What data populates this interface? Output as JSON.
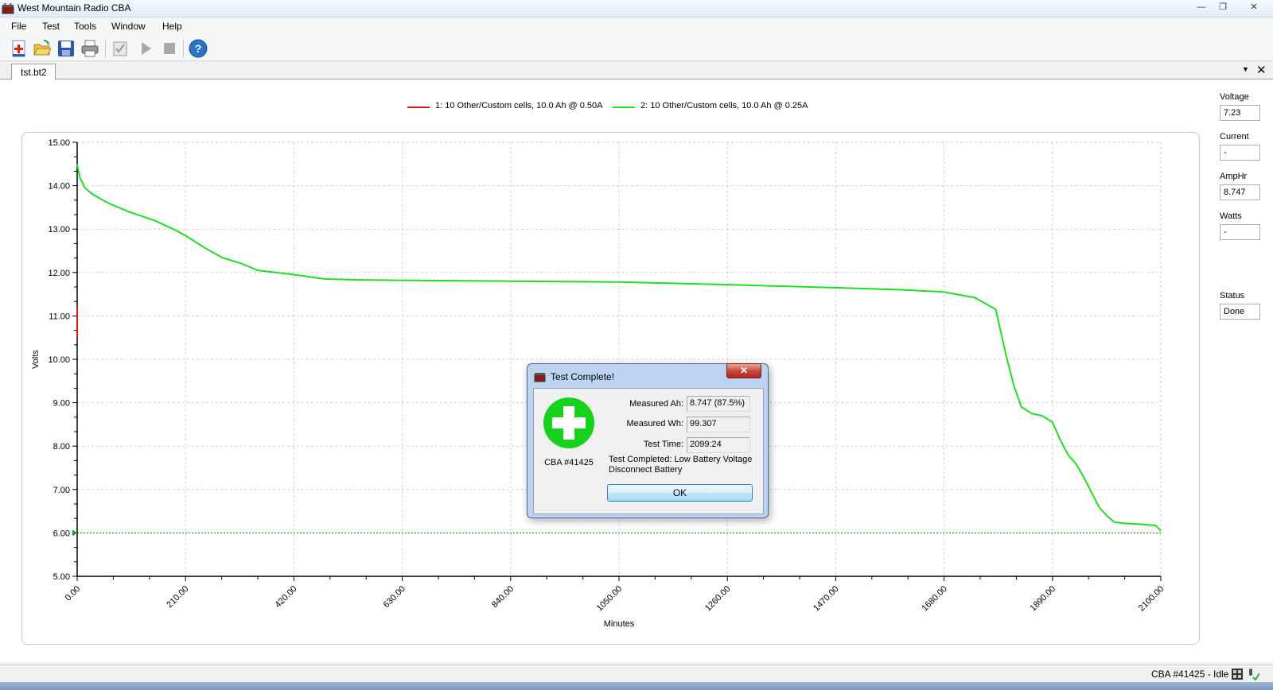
{
  "window": {
    "title": "West Mountain Radio CBA"
  },
  "menu": [
    "File",
    "Test",
    "Tools",
    "Window",
    "Help"
  ],
  "toolbar": [
    "new-icon",
    "open-icon",
    "save-icon",
    "print-icon",
    "checklist-icon",
    "play-icon",
    "stop-icon",
    "help-icon"
  ],
  "tab": {
    "label": "tst.bt2"
  },
  "legend": [
    {
      "label": "1: 10 Other/Custom cells, 10.0 Ah @ 0.50A",
      "color": "#c8201e"
    },
    {
      "label": "2: 10 Other/Custom cells, 10.0 Ah @ 0.25A",
      "color": "#22dd22"
    }
  ],
  "readouts": [
    {
      "label": "Voltage",
      "value": "7.23"
    },
    {
      "label": "Current",
      "value": "-"
    },
    {
      "label": "AmpHr",
      "value": "8.747"
    },
    {
      "label": "Watts",
      "value": "-"
    },
    {
      "label": "Status",
      "value": "Done"
    }
  ],
  "chart_data": {
    "type": "line",
    "xlabel": "Minutes",
    "ylabel": "Volts",
    "xlim": [
      0,
      2100
    ],
    "ylim": [
      5,
      15
    ],
    "xticks": [
      "0.00",
      "210.00",
      "420.00",
      "630.00",
      "840.00",
      "1050.00",
      "1260.00",
      "1470.00",
      "1680.00",
      "1890.00",
      "2100.00"
    ],
    "yticks": [
      "15.00",
      "14.00",
      "13.00",
      "12.00",
      "11.00",
      "10.00",
      "9.00",
      "8.00",
      "7.00",
      "6.00",
      "5.00"
    ],
    "grid": true,
    "cutoff_voltage": 6.0,
    "series": [
      {
        "name": "1: 10 Other/Custom cells, 10.0 Ah @ 0.50A",
        "color": "#c8201e",
        "x": [
          0,
          0
        ],
        "y": [
          10.5,
          11.2
        ]
      },
      {
        "name": "2: 10 Other/Custom cells, 10.0 Ah @ 0.25A",
        "color": "#22dd22",
        "x": [
          0,
          5,
          15,
          30,
          60,
          100,
          150,
          190,
          210,
          250,
          280,
          320,
          350,
          400,
          420,
          480,
          550,
          630,
          840,
          1050,
          1260,
          1470,
          1600,
          1680,
          1740,
          1780,
          1800,
          1815,
          1830,
          1850,
          1870,
          1890,
          1905,
          1920,
          1935,
          1950,
          1965,
          1980,
          1995,
          2010,
          2030,
          2060,
          2090,
          2100
        ],
        "y": [
          14.5,
          14.2,
          13.95,
          13.8,
          13.6,
          13.4,
          13.2,
          12.98,
          12.85,
          12.55,
          12.35,
          12.2,
          12.05,
          11.98,
          11.95,
          11.85,
          11.83,
          11.82,
          11.8,
          11.78,
          11.72,
          11.65,
          11.6,
          11.55,
          11.42,
          11.15,
          10.1,
          9.4,
          8.9,
          8.75,
          8.7,
          8.55,
          8.15,
          7.8,
          7.6,
          7.3,
          6.95,
          6.6,
          6.4,
          6.25,
          6.22,
          6.2,
          6.17,
          6.05
        ]
      }
    ]
  },
  "dialog": {
    "title": "Test Complete!",
    "close_label": "✕",
    "device": "CBA #41425",
    "measured_ah_label": "Measured Ah:",
    "measured_ah": "8.747 (87.5%)",
    "measured_wh_label": "Measured Wh:",
    "measured_wh": "99.307",
    "test_time_label": "Test Time:",
    "test_time": "2099:24",
    "message_line1": "Test Completed: Low Battery Voltage",
    "message_line2": "Disconnect Battery",
    "ok_label": "OK"
  },
  "status": {
    "text": "CBA #41425 - Idle"
  }
}
